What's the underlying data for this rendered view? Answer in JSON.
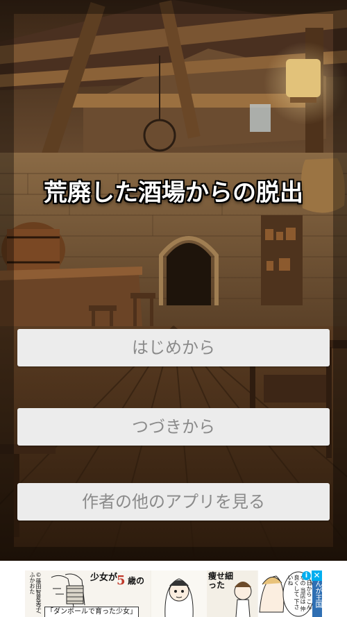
{
  "game": {
    "title": "荒廃した酒場からの脱出"
  },
  "menu": {
    "start_label": "はじめから",
    "continue_label": "つづきから",
    "other_apps_label": "作者の他のアプリを見る"
  },
  "ad": {
    "author_credit": "©篠田智夏美子/ふかおた",
    "girl_text": "少女が",
    "age_number": "5",
    "age_suffix": "歳の",
    "caption": "「ダンボールで育った少女」",
    "thin_text": "痩せ細った",
    "dialogue": "…日から こんなの 当店は 仲良くして 下さいね",
    "kingdom_label": "んが王国",
    "info_icon": "i",
    "close_icon": "✕"
  },
  "colors": {
    "button_bg": "#ececec",
    "button_text": "#8a8a8a",
    "title_text": "#ffffff",
    "title_outline": "#000000",
    "ad_info": "#00aeef",
    "ad_kingdom": "#2f6fb3"
  }
}
